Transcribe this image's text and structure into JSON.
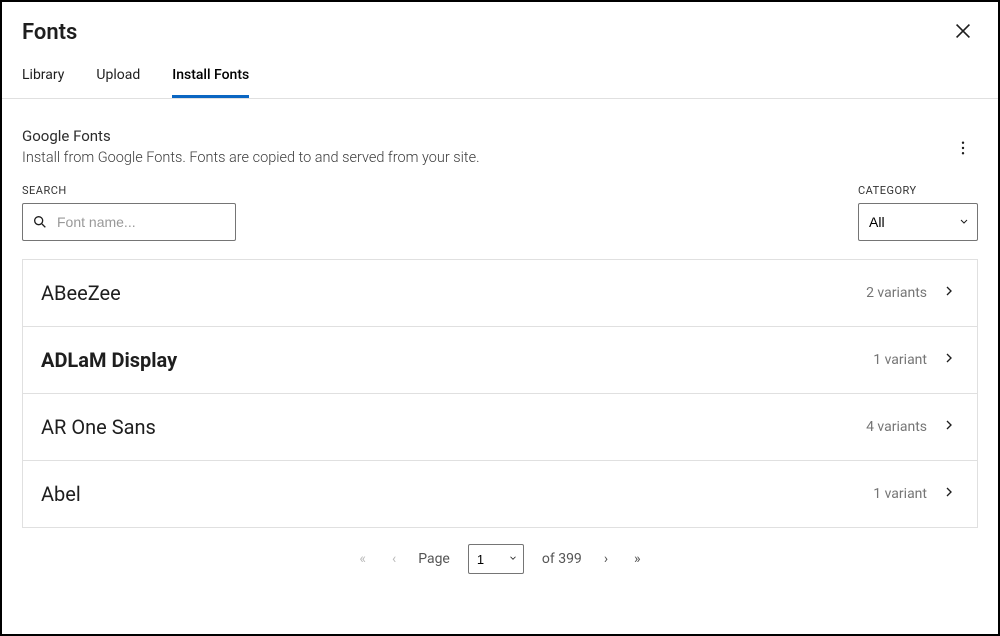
{
  "title": "Fonts",
  "tabs": [
    {
      "label": "Library",
      "active": false
    },
    {
      "label": "Upload",
      "active": false
    },
    {
      "label": "Install Fonts",
      "active": true
    }
  ],
  "section": {
    "heading": "Google Fonts",
    "description": "Install from Google Fonts. Fonts are copied to and served from your site."
  },
  "search": {
    "label": "SEARCH",
    "placeholder": "Font name..."
  },
  "category": {
    "label": "CATEGORY",
    "value": "All"
  },
  "fonts": [
    {
      "name": "ABeeZee",
      "variants": "2 variants",
      "bold": false
    },
    {
      "name": "ADLaM Display",
      "variants": "1 variant",
      "bold": true
    },
    {
      "name": "AR One Sans",
      "variants": "4 variants",
      "bold": false
    },
    {
      "name": "Abel",
      "variants": "1 variant",
      "bold": false
    }
  ],
  "pager": {
    "page_label": "Page",
    "current": "1",
    "of_label": "of 399"
  }
}
